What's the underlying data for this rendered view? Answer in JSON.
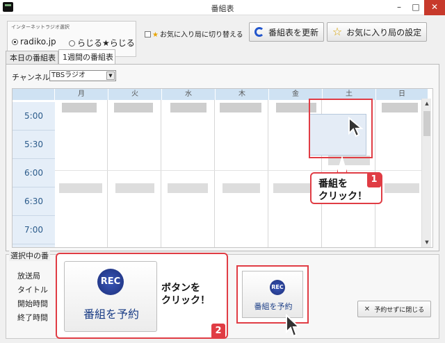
{
  "window": {
    "title": "番組表",
    "min_glyph": "–",
    "max_glyph": "□",
    "close_glyph": "✕"
  },
  "toolbar": {
    "group_title": "インターネットラジオ選択",
    "radio_radiko": "radiko.jp",
    "radio_radiru": "らじる★らじる",
    "fav_toggle": "お気に入り局に切り替える",
    "refresh_label": "番組表を更新",
    "fav_settings_label": "お気に入り局の設定"
  },
  "tabs": [
    {
      "label": "本日の番組表"
    },
    {
      "label": "1週間の番組表"
    }
  ],
  "channel": {
    "label": "チャンネル",
    "value": "TBSラジオ"
  },
  "days": [
    "月",
    "火",
    "水",
    "木",
    "金",
    "土",
    "日"
  ],
  "times": [
    "5:00",
    "5:30",
    "6:00",
    "6:30",
    "7:00"
  ],
  "info": {
    "title": "選択中の番",
    "station": "放送局",
    "program": "タイトル",
    "start": "開始時間",
    "end": "終了時間"
  },
  "actions": {
    "rec_big_label": "番組を予約",
    "rec_small_label": "番組を予約",
    "rec_logo": "REC",
    "close_without": "予約せずに閉じる"
  },
  "callouts": {
    "step1_line1": "番組を",
    "step1_line2": "クリック！",
    "step1_number": "1",
    "step2_line1": "ボタンを",
    "step2_line2": "クリック！",
    "step2_number": "2"
  },
  "colors": {
    "accent": "#e03c44",
    "header": "#cfe2f3",
    "brand_blue": "#1a3d86"
  }
}
